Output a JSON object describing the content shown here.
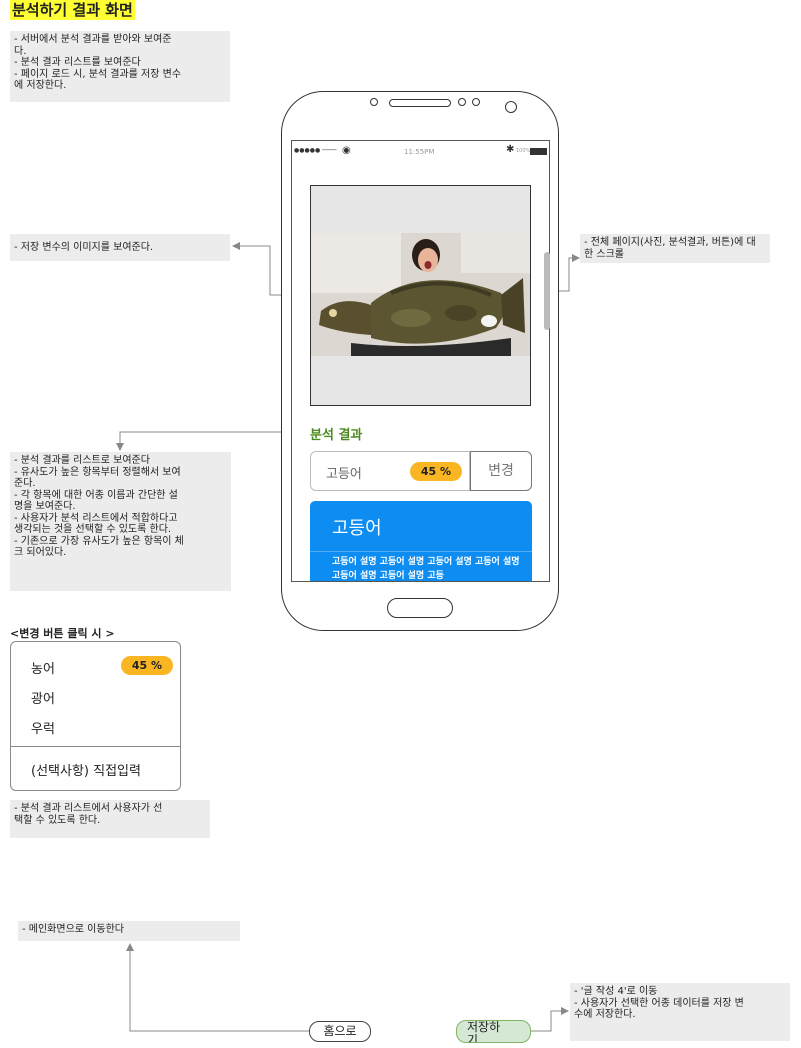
{
  "title": "분석하기 결과 화면",
  "notes": {
    "top": "- 서버에서 분석 결과를 받아와 보여준\n다.\n- 분석 결과 리스트를 보여준다\n- 페이지 로드 시, 분석 결과를 저장 변수\n에 저장한다.",
    "image": "- 저장 변수의 이미지를 보여준다.",
    "scroll": "- 전체 페이지(사진, 분석결과, 버튼)에 대\n한 스크롤",
    "list": "- 분석 결과를 리스트로 보여준다\n- 유사도가 높은 항목부터 정렬해서 보여\n준다.\n- 각 항목에 대한 어종 이름과 간단한 설\n명을 보여준다.\n- 사용자가 분석 리스트에서 적합하다고\n생각되는 것을 선택할 수 있도록 한다.\n- 기존으로 가장 유사도가 높은 항목이 체\n크 되어있다.",
    "dropdown": "- 분석 결과 리스트에서 사용자가 선\n택할 수 있도록 한다.",
    "home": "- 메인화면으로 이동한다",
    "save": "- '글 작성 4'로 이동\n- 사용자가 선택한 어종 데이터를 저장 변\n수에 저장한다."
  },
  "phone": {
    "status": {
      "carrier": "●●●●● ────",
      "time": "11:55PM",
      "battery": "100%"
    },
    "section_title": "분석 결과",
    "result": {
      "name": "고등어",
      "percent": "45 %",
      "change_label": "변경"
    },
    "card": {
      "title": "고등어",
      "desc": "고등어 설명 고등어 설명 고등어 설명 고등어 설명 고등어 설명 고등어 설명 고등"
    }
  },
  "dropdown": {
    "heading": "<변경 버튼 클릭 시 >",
    "items": [
      "농어",
      "광어",
      "우럭"
    ],
    "percent": "45 %",
    "manual": "(선택사항) 직접입력"
  },
  "buttons": {
    "home": "홈으로",
    "save": "저장하기"
  },
  "colors": {
    "title_highlight": "#ffff33",
    "card_blue": "#0d8cf2",
    "badge": "#f9b522",
    "section_green": "#4b8a1e",
    "save_fill": "#d5e8d4"
  }
}
